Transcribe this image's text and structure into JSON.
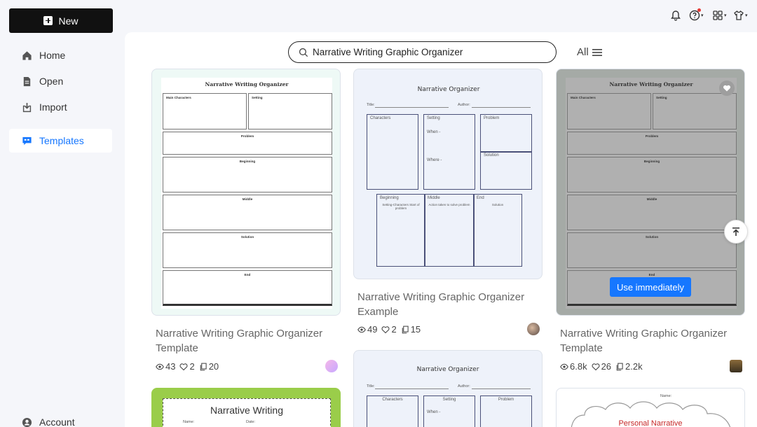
{
  "sidebar": {
    "new_label": "New",
    "items": [
      {
        "label": "Home",
        "icon": "home-icon"
      },
      {
        "label": "Open",
        "icon": "file-icon"
      },
      {
        "label": "Import",
        "icon": "import-icon"
      },
      {
        "label": "Templates",
        "icon": "templates-icon"
      }
    ],
    "account_label": "Account"
  },
  "search": {
    "value": "Narrative Writing Graphic Organizer",
    "filter_label": "All"
  },
  "colors": {
    "accent": "#1677ff",
    "sidebar_bg": "#f5f6fa",
    "new_button": "#111111"
  },
  "cards": [
    {
      "title": "Narrative Writing Graphic Organizer Template",
      "views": "43",
      "likes": "2",
      "copies": "20",
      "preview": {
        "title": "Narrative Writing Organizer",
        "boxes": [
          "Main Characters",
          "Setting",
          "Problem",
          "Beginning",
          "Middle",
          "Solution",
          "End"
        ]
      }
    },
    {
      "title": "Narrative Writing Graphic Organizer Example",
      "views": "49",
      "likes": "2",
      "copies": "15",
      "preview": {
        "title": "Narrative Organizer",
        "title_field": "Title:",
        "author_field": "Author:",
        "characters": "Characters",
        "setting": "Setting",
        "when": "When -",
        "where": "Where -",
        "problem": "Problem",
        "solution": "Solution",
        "beginning": "Beginning",
        "middle": "Middle",
        "end": "End",
        "beginning_note": "Setting-Characters Start of problem",
        "middle_note": "Action taken to solve problem",
        "end_note": "Solution"
      }
    },
    {
      "title": "Narrative Writing Graphic Organizer Template",
      "views": "6.8k",
      "likes": "26",
      "copies": "2.2k",
      "use_button": "Use immediately",
      "preview": {
        "title": "Narrative Writing Organizer",
        "boxes": [
          "Main Characters",
          "Setting",
          "Problem",
          "Beginning",
          "Middle",
          "Solution",
          "End"
        ]
      }
    },
    {
      "preview": {
        "title": "Narrative Writing",
        "name": "Name:",
        "date": "Date:"
      }
    },
    {
      "preview": {
        "title": "Narrative Organizer",
        "title_field": "Title:",
        "author_field": "Author:",
        "characters": "Characters",
        "setting": "Setting",
        "problem": "Problem",
        "when": "When -"
      }
    },
    {
      "preview": {
        "name": "Name:",
        "title": "Personal Narrative"
      }
    }
  ]
}
